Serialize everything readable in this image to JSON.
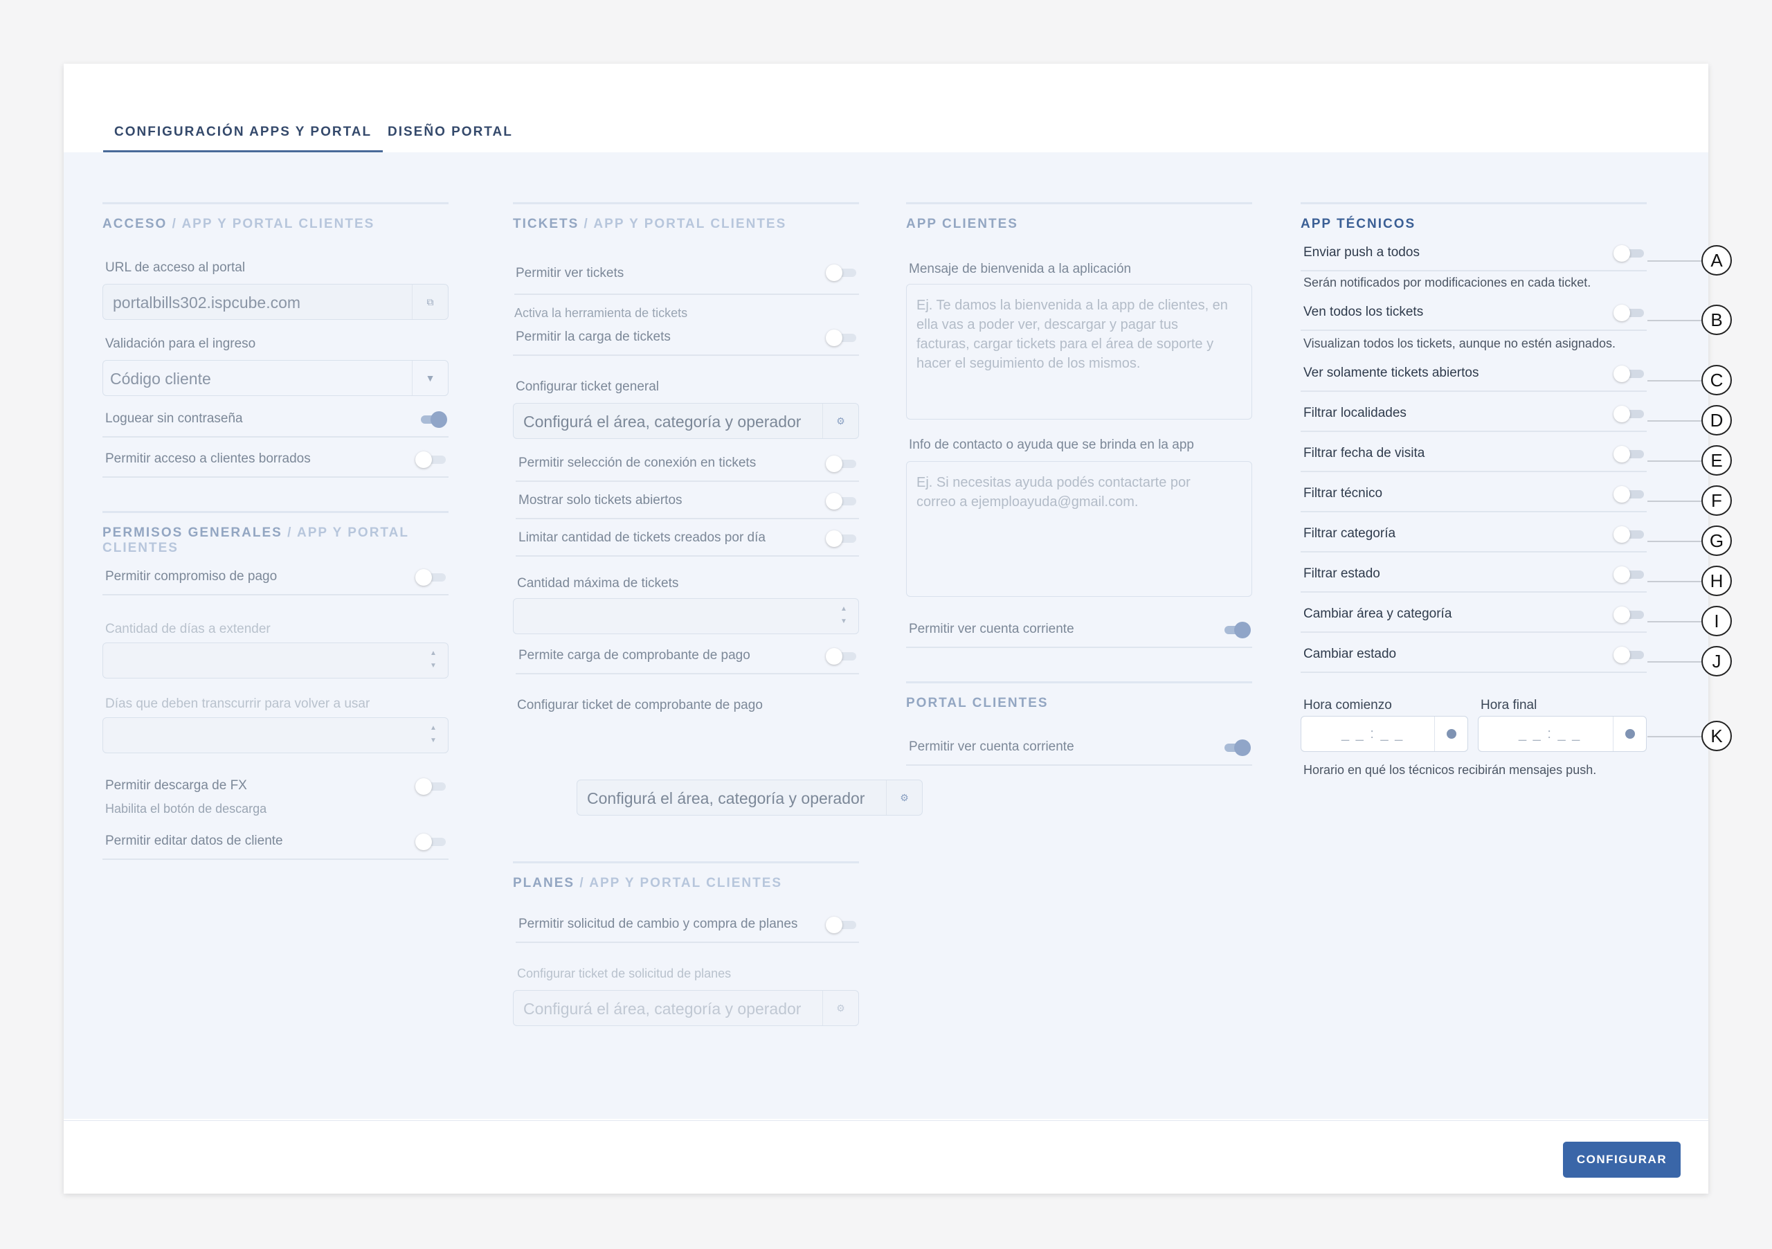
{
  "tabs": [
    "CONFIGURACIÓN APPS Y PORTAL",
    "DISEÑO PORTAL"
  ],
  "acceso": {
    "title": "ACCESO",
    "sep": " / ",
    "subtitle": "APP Y PORTAL CLIENTES",
    "url_label": "URL de acceso al portal",
    "url_value": "portalbills302.ispcube.com",
    "validacion_label": "Validación para el ingreso",
    "validacion_value": "Código cliente",
    "loguear": "Loguear sin contraseña",
    "borrados": "Permitir acceso a clientes borrados"
  },
  "permisos": {
    "title": "PERMISOS GENERALES",
    "sep": " / ",
    "subtitle": "APP Y PORTAL CLIENTES",
    "compromiso": "Permitir compromiso de pago",
    "dias_extender": "Cantidad de días a extender",
    "dias_transcurrir": "Días que deben transcurrir para volver a usar",
    "descarga_fx": "Permitir descarga de FX",
    "descarga_hint": "Habilita el botón de descarga",
    "editar": "Permitir editar datos de cliente"
  },
  "tickets": {
    "title": "TICKETS",
    "sep": " / ",
    "subtitle": "APP Y PORTAL CLIENTES",
    "ver": "Permitir ver tickets",
    "ver_hint": "Activa la herramienta de tickets",
    "carga": "Permitir la carga de tickets",
    "config_general": "Configurar ticket general",
    "placeholder": "Configurá el área, categoría y operador",
    "seleccion": "Permitir selección de conexión en tickets",
    "solo_abiertos": "Mostrar solo tickets abiertos",
    "limitar": "Limitar cantidad de tickets creados por día",
    "cantidad_max": "Cantidad máxima de tickets",
    "comprobante": "Permite carga de comprobante de pago",
    "config_comprobante": "Configurar ticket de comprobante de pago"
  },
  "planes": {
    "title": "PLANES",
    "sep": " / ",
    "subtitle": "APP Y PORTAL CLIENTES",
    "solicitud": "Permitir solicitud de cambio y compra de planes",
    "config_solicitud": "Configurar ticket de solicitud de planes",
    "placeholder": "Configurá el área, categoría y operador"
  },
  "app_clientes": {
    "title": "APP CLIENTES",
    "bienvenida_label": "Mensaje de bienvenida a la aplicación",
    "bienvenida_ph": "Ej. Te damos la bienvenida a la app de clientes, en ella vas a poder ver, descargar y pagar tus facturas, cargar tickets para el área de soporte y hacer el seguimiento de los mismos.",
    "contacto_label": "Info de contacto o ayuda que se brinda en la app",
    "contacto_ph": "Ej. Si necesitas ayuda podés contactarte por correo a ejemploayuda@gmail.com.",
    "cuenta": "Permitir ver cuenta corriente"
  },
  "portal_clientes": {
    "title": "PORTAL CLIENTES",
    "cuenta": "Permitir ver cuenta corriente"
  },
  "app_tecnicos": {
    "title": "APP TÉCNICOS",
    "push": "Enviar push a todos",
    "push_hint": "Serán notificados por modificaciones en cada ticket.",
    "ven_todos": "Ven todos los tickets",
    "ven_hint": "Visualizan todos los tickets, aunque no estén asignados.",
    "solo_abiertos": "Ver solamente tickets abiertos",
    "localidades": "Filtrar localidades",
    "fecha": "Filtrar fecha de visita",
    "tecnico": "Filtrar técnico",
    "categoria": "Filtrar categoría",
    "estado": "Filtrar estado",
    "cambiar_area": "Cambiar área y categoría",
    "cambiar_estado": "Cambiar estado",
    "hora_comienzo": "Hora comienzo",
    "hora_final": "Hora final",
    "time_ph": "_ _ : _ _",
    "horario_hint": "Horario en qué los técnicos recibirán mensajes push."
  },
  "callouts": [
    "A",
    "B",
    "C",
    "D",
    "E",
    "F",
    "G",
    "H",
    "I",
    "J",
    "K"
  ],
  "footer": {
    "configurar": "CONFIGURAR"
  }
}
